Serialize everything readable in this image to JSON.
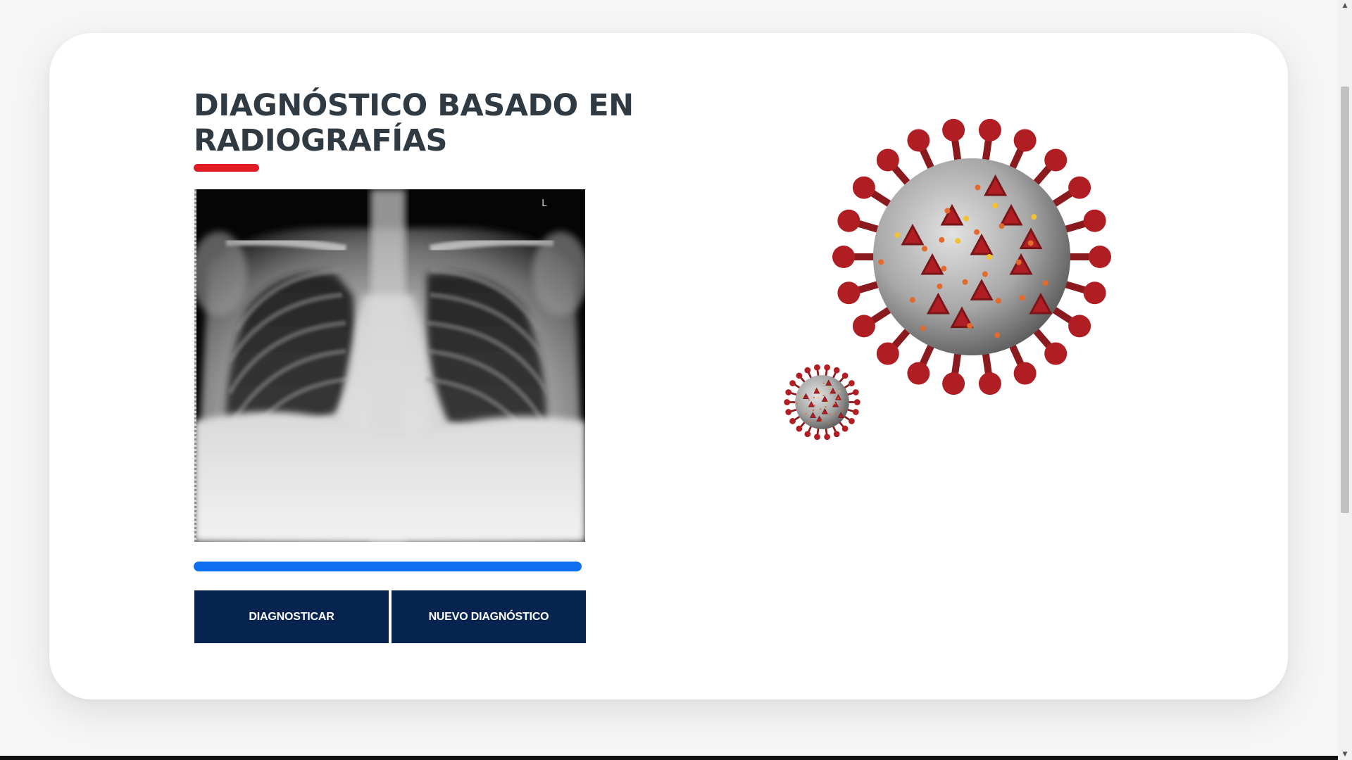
{
  "main": {
    "title": "DIAGNÓSTICO BASADO EN RADIOGRAFÍAS",
    "xray_marker": "L",
    "progress_fraction": 1.0,
    "buttons": {
      "diagnose_label": "DIAGNOSTICAR",
      "new_label": "NUEVO DIAGNÓSTICO"
    }
  },
  "scrollbar": {
    "up_icon": "▲",
    "down_icon": "▼"
  },
  "colors": {
    "accent_red": "#e01b24",
    "progress_blue": "#0d6ef0",
    "button_navy": "#07234f",
    "title_dark": "#2f3a43",
    "virus_red": "#b01e23",
    "virus_grey": "#a8a8a8"
  },
  "icons": [
    "chest-xray-image",
    "coronavirus-large-illustration",
    "coronavirus-small-illustration",
    "scroll-up-icon",
    "scroll-down-icon"
  ]
}
